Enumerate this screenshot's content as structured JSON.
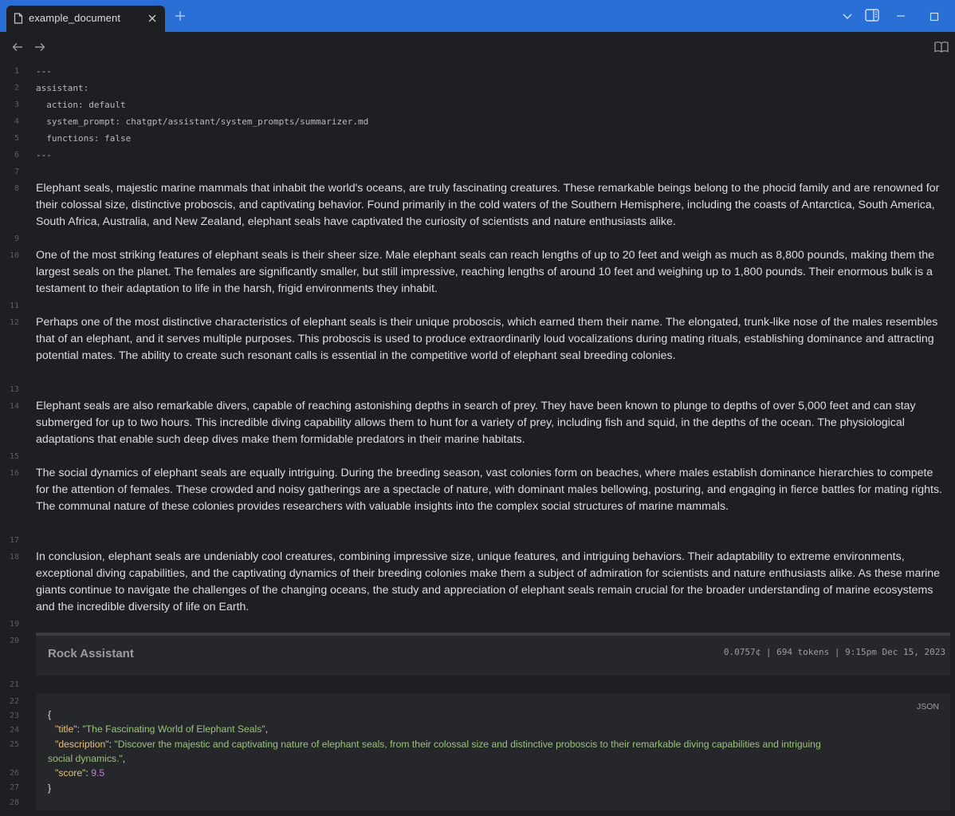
{
  "tab": {
    "title": "example_document"
  },
  "frontmatter": [
    "---",
    "assistant:",
    "  action: default",
    "  system_prompt: chatgpt/assistant/system_prompts/summarizer.md",
    "  functions: false",
    "---"
  ],
  "line_numbers": [
    "1",
    "2",
    "3",
    "4",
    "5",
    "6",
    "7",
    "8",
    "9",
    "10",
    "11",
    "12",
    "13",
    "14",
    "15",
    "16",
    "17",
    "18",
    "19",
    "20",
    "21",
    "22",
    "23",
    "24",
    "25",
    "26",
    "27",
    "28"
  ],
  "paragraphs": [
    "Elephant seals, majestic marine mammals that inhabit the world's oceans, are truly fascinating creatures. These remarkable beings belong to the phocid family and are renowned for their colossal size, distinctive proboscis, and captivating behavior. Found primarily in the cold waters of the Southern Hemisphere, including the coasts of Antarctica, South America, South Africa, Australia, and New Zealand, elephant seals have captivated the curiosity of scientists and nature enthusiasts alike.",
    "One of the most striking features of elephant seals is their sheer size. Male elephant seals can reach lengths of up to 20 feet and weigh as much as 8,800 pounds, making them the largest seals on the planet. The females are significantly smaller, but still impressive, reaching lengths of around 10 feet and weighing up to 1,800 pounds. Their enormous bulk is a testament to their adaptation to life in the harsh, frigid environments they inhabit.",
    "Perhaps one of the most distinctive characteristics of elephant seals is their unique proboscis, which earned them their name. The elongated, trunk-like nose of the males resembles that of an elephant, and it serves multiple purposes. This proboscis is used to produce extraordinarily loud vocalizations during mating rituals, establishing dominance and attracting potential mates. The ability to create such resonant calls is essential in the competitive world of elephant seal breeding colonies.",
    "Elephant seals are also remarkable divers, capable of reaching astonishing depths in search of prey. They have been known to plunge to depths of over 5,000 feet and can stay submerged for up to two hours. This incredible diving capability allows them to hunt for a variety of prey, including fish and squid, in the depths of the ocean. The physiological adaptations that enable such deep dives make them formidable predators in their marine habitats.",
    "The social dynamics of elephant seals are equally intriguing. During the breeding season, vast colonies form on beaches, where males establish dominance hierarchies to compete for the attention of females. These crowded and noisy gatherings are a spectacle of nature, with dominant males bellowing, posturing, and engaging in fierce battles for mating rights. The communal nature of these colonies provides researchers with valuable insights into the complex social structures of marine mammals.",
    "In conclusion, elephant seals are undeniably cool creatures, combining impressive size, unique features, and intriguing behaviors. Their adaptability to extreme environments, exceptional diving capabilities, and the captivating dynamics of their breeding colonies make them a subject of admiration for scientists and nature enthusiasts alike. As these marine giants continue to navigate the challenges of the changing oceans, the study and appreciation of elephant seals remain crucial for the broader understanding of marine ecosystems and the incredible diversity of life on Earth."
  ],
  "assistant": {
    "name": "Rock Assistant",
    "meta": "0.0757¢ | 694 tokens | 9:15pm Dec 15, 2023"
  },
  "json_block": {
    "language": "JSON",
    "open_brace": "{",
    "close_brace": "}",
    "title_key": "\"title\"",
    "title_value": "\"The Fascinating World of Elephant Seals\"",
    "description_key": "\"description\"",
    "description_value_line1": "\"Discover the majestic and captivating nature of elephant seals, from their colossal size and distinctive proboscis to their remarkable diving capabilities and intriguing",
    "description_value_line2": "social dynamics.\"",
    "score_key": "\"score\"",
    "score_value": "9.5"
  }
}
